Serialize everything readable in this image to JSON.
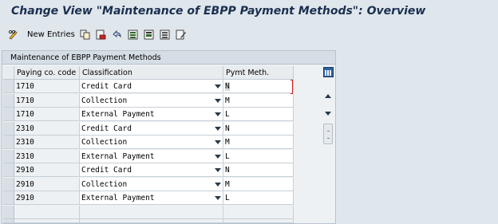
{
  "window": {
    "title": "Change View \"Maintenance of EBPP Payment Methods\": Overview"
  },
  "toolbar": {
    "new_entries_label": "New Entries",
    "icons": [
      "pencil-glasses-icon",
      "copy-icon",
      "delete-icon",
      "undo-icon",
      "select-all-icon",
      "select-block-icon",
      "deselect-all-icon",
      "print-icon"
    ]
  },
  "panel": {
    "title": "Maintenance of EBPP Payment Methods"
  },
  "table": {
    "columns": {
      "paying_co_code": "Paying co. code",
      "classification": "Classification",
      "pymt_meth": "Pymt Meth."
    },
    "rows": [
      {
        "code": "1710",
        "classification": "Credit Card",
        "method": "N"
      },
      {
        "code": "1710",
        "classification": "Collection",
        "method": "M"
      },
      {
        "code": "1710",
        "classification": "External Payment",
        "method": "L"
      },
      {
        "code": "2310",
        "classification": "Credit Card",
        "method": "N"
      },
      {
        "code": "2310",
        "classification": "Collection",
        "method": "M"
      },
      {
        "code": "2310",
        "classification": "External Payment",
        "method": "L"
      },
      {
        "code": "2910",
        "classification": "Credit Card",
        "method": "N"
      },
      {
        "code": "2910",
        "classification": "Collection",
        "method": "M"
      },
      {
        "code": "2910",
        "classification": "External Payment",
        "method": "L"
      }
    ]
  },
  "colors": {
    "title": "#1a2f4f",
    "background": "#dfe6ec",
    "input_bg": "#ffffff",
    "focus_marker": "#d02020"
  }
}
